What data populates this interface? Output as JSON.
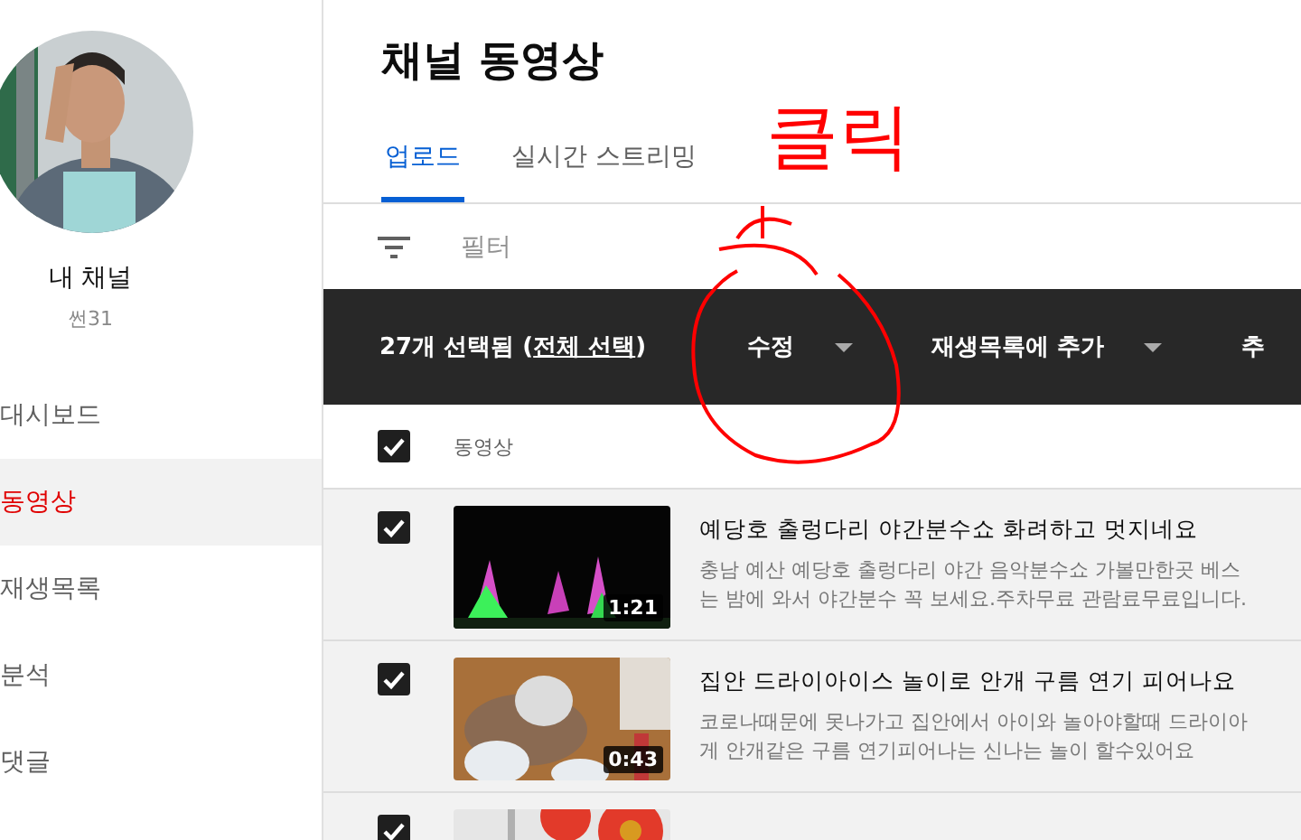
{
  "sidebar": {
    "channel_name": "내 채널",
    "channel_subtitle": "썬31",
    "items": [
      {
        "label": "대시보드",
        "selected": false
      },
      {
        "label": "동영상",
        "selected": true
      },
      {
        "label": "재생목록",
        "selected": false
      },
      {
        "label": "분석",
        "selected": false
      },
      {
        "label": "댓글",
        "selected": false
      }
    ]
  },
  "page_title": "채널 동영상",
  "tabs": [
    {
      "label": "업로드",
      "selected": true
    },
    {
      "label": "실시간 스트리밍",
      "selected": false
    }
  ],
  "filter": {
    "placeholder": "필터"
  },
  "selection_bar": {
    "count_text": "27개 선택됨 (**전체 선택**)",
    "actions": [
      "수정",
      "재생목록에 추가",
      "추"
    ]
  },
  "table": {
    "header_checked": true,
    "column": "동영상",
    "rows": [
      {
        "checked": true,
        "title": "예당호 출렁다리 야간분수쇼 화려하고 멋지네요",
        "description": [
          "충남 예산 예당호 출렁다리 야간 음악분수쇼 가볼만한곳 베스",
          "는 밤에 와서 야간분수 꼭 보세요.주차무료 관람료무료입니다."
        ],
        "duration": "1:21",
        "thumbnail": {
          "kind": "picture"
        }
      },
      {
        "checked": true,
        "title": "집안 드라이아이스 놀이로 안개 구름 연기 피어나요",
        "description": [
          "코로나때문에 못나가고 집안에서 아이와 놀아야할때 드라이아",
          "게 안개같은 구름 연기피어나는 신나는 놀이 할수있어요"
        ],
        "duration": "0:43",
        "thumbnail": {
          "kind": "picture"
        }
      },
      {
        "checked": true,
        "thumbnail": {
          "kind": "picture"
        }
      }
    ]
  },
  "annotation": {
    "text": "클릭"
  }
}
